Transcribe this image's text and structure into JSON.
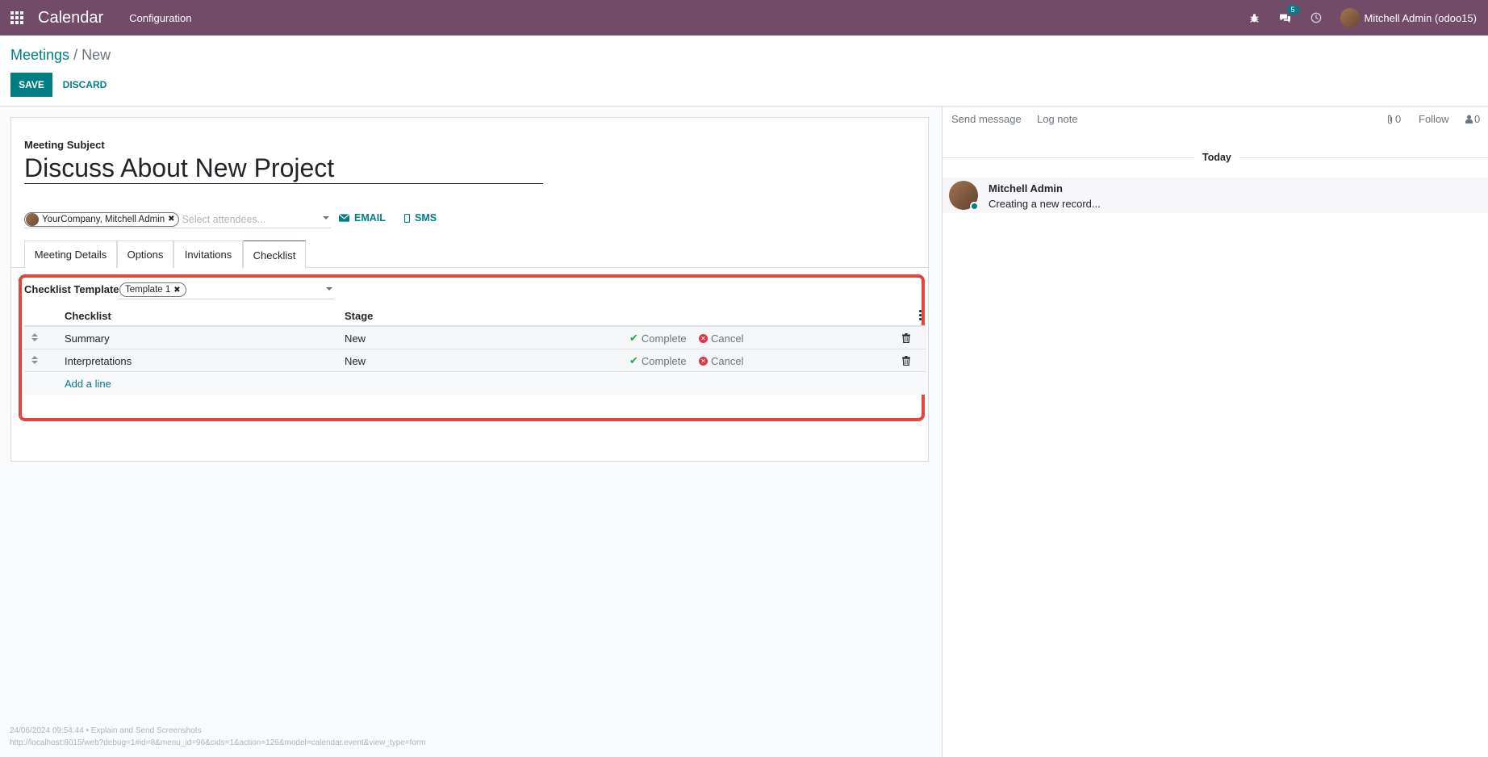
{
  "navbar": {
    "app_name": "Calendar",
    "menu": [
      "Configuration"
    ],
    "messages_badge": "5",
    "user_name": "Mitchell Admin (odoo15)",
    "icons": [
      "apps-grid-icon",
      "bug-icon",
      "chat-bubbles-icon",
      "clock-icon"
    ],
    "bg_color": "#714b67"
  },
  "breadcrumb": {
    "parent": "Meetings",
    "separator": "/",
    "current": "New"
  },
  "actions": {
    "save": "SAVE",
    "discard": "DISCARD",
    "accent_color": "#017e84"
  },
  "form": {
    "subject_label": "Meeting Subject",
    "subject_value": "Discuss About New Project",
    "attendee_tag": "YourCompany, Mitchell Admin",
    "attendee_placeholder": "Select attendees...",
    "email_label": "EMAIL",
    "sms_label": "SMS",
    "tabs": [
      "Meeting Details",
      "Options",
      "Invitations",
      "Checklist"
    ],
    "active_tab": "Checklist"
  },
  "checklist": {
    "template_label": "Checklist Template",
    "template_value": "Template 1",
    "columns": [
      "Checklist",
      "Stage"
    ],
    "rows": [
      {
        "name": "Summary",
        "stage": "New",
        "complete": "Complete",
        "cancel": "Cancel"
      },
      {
        "name": "Interpretations",
        "stage": "New",
        "complete": "Complete",
        "cancel": "Cancel"
      }
    ],
    "add_line": "Add a line",
    "highlight_color": "#e0463e"
  },
  "chatter": {
    "send_message": "Send message",
    "log_note": "Log note",
    "attachments_count": "0",
    "follow": "Follow",
    "followers_count": "0",
    "date_separator": "Today",
    "message": {
      "author": "Mitchell Admin",
      "body": "Creating a new record..."
    }
  },
  "footer": {
    "line1": "24/06/2024 09:54:44 • Explain and Send Screenshots",
    "line2": "http://localhost:8015/web?debug=1#id=8&menu_id=96&cids=1&action=126&model=calendar.event&view_type=form"
  }
}
